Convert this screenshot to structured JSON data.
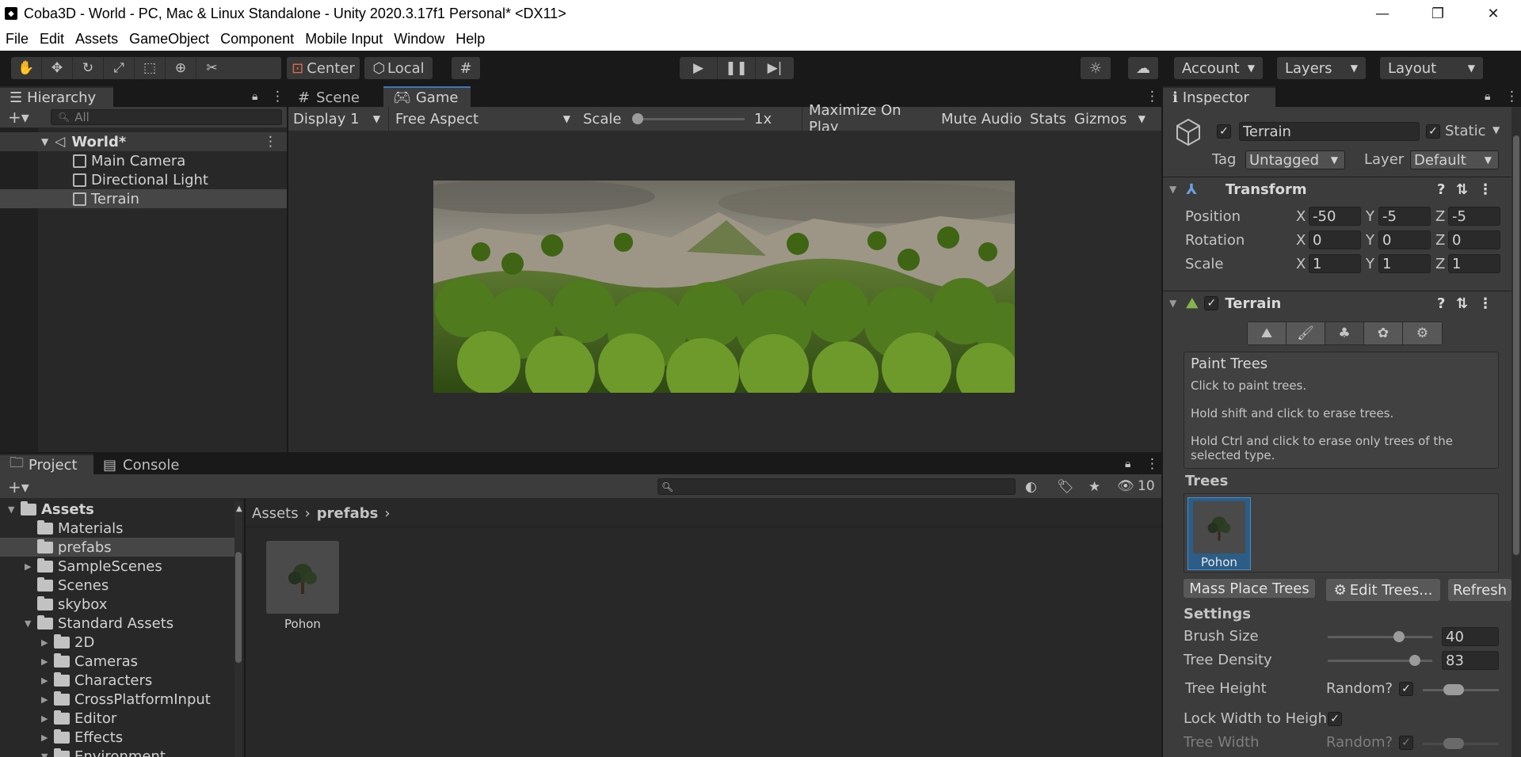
{
  "window": {
    "title": "Coba3D - World - PC, Mac & Linux Standalone - Unity 2020.3.17f1 Personal* <DX11>",
    "controls": [
      "—",
      "❐",
      "✕"
    ]
  },
  "menu": [
    "File",
    "Edit",
    "Assets",
    "GameObject",
    "Component",
    "Mobile Input",
    "Window",
    "Help"
  ],
  "toolbar": {
    "pivot_label": "Center",
    "space_label": "Local",
    "account_label": "Account",
    "layers_label": "Layers",
    "layout_label": "Layout"
  },
  "hierarchy": {
    "tab": "Hierarchy",
    "search_placeholder": "All",
    "scene": "World*",
    "items": [
      "Main Camera",
      "Directional Light",
      "Terrain"
    ],
    "selected": "Terrain"
  },
  "view": {
    "tabs": [
      "Scene",
      "Game"
    ],
    "active_tab": "Game",
    "display": "Display 1",
    "aspect": "Free Aspect",
    "scale_label": "Scale",
    "scale_value": "1x",
    "maximize": "Maximize On Play",
    "mute": "Mute Audio",
    "stats": "Stats",
    "gizmos": "Gizmos"
  },
  "project": {
    "tabs": [
      "Project",
      "Console"
    ],
    "hidden_count": "10",
    "tree": [
      {
        "label": "Assets",
        "indent": 0,
        "bold": true
      },
      {
        "label": "Materials",
        "indent": 1
      },
      {
        "label": "prefabs",
        "indent": 1,
        "selected": true
      },
      {
        "label": "SampleScenes",
        "indent": 1,
        "arrow": true
      },
      {
        "label": "Scenes",
        "indent": 1
      },
      {
        "label": "skybox",
        "indent": 1
      },
      {
        "label": "Standard Assets",
        "indent": 1,
        "open": true
      },
      {
        "label": "2D",
        "indent": 2,
        "arrow": true
      },
      {
        "label": "Cameras",
        "indent": 2,
        "arrow": true
      },
      {
        "label": "Characters",
        "indent": 2,
        "arrow": true
      },
      {
        "label": "CrossPlatformInput",
        "indent": 2,
        "arrow": true
      },
      {
        "label": "Editor",
        "indent": 2,
        "arrow": true
      },
      {
        "label": "Effects",
        "indent": 2,
        "arrow": true
      },
      {
        "label": "Environment",
        "indent": 2,
        "open": true
      }
    ],
    "breadcrumb": [
      "Assets",
      "prefabs"
    ],
    "asset": "Pohon"
  },
  "inspector": {
    "tab": "Inspector",
    "object_name": "Terrain",
    "static_label": "Static",
    "tag_label": "Tag",
    "tag_value": "Untagged",
    "layer_label": "Layer",
    "layer_value": "Default",
    "transform": {
      "title": "Transform",
      "rows": [
        {
          "label": "Position",
          "x": "-50",
          "y": "-5",
          "z": "-5"
        },
        {
          "label": "Rotation",
          "x": "0",
          "y": "0",
          "z": "0"
        },
        {
          "label": "Scale",
          "x": "1",
          "y": "1",
          "z": "1"
        }
      ]
    },
    "terrain": {
      "title": "Terrain",
      "help_title": "Paint Trees",
      "help_lines": [
        "Click to paint trees.",
        "Hold shift and click to erase trees.",
        "Hold Ctrl and click to erase only trees of the selected type."
      ],
      "trees_label": "Trees",
      "tree_name": "Pohon",
      "mass_place": "Mass Place Trees",
      "edit_trees": "Edit Trees...",
      "refresh": "Refresh",
      "settings_label": "Settings",
      "brush_size_label": "Brush Size",
      "brush_size": "40",
      "brush_size_fraction": 0.68,
      "tree_density_label": "Tree Density",
      "tree_density": "83",
      "tree_density_fraction": 0.83,
      "tree_height_label": "Tree Height",
      "random_label": "Random?",
      "lock_width_label": "Lock Width to Heigh",
      "tree_width_label": "Tree Width",
      "random2_label": "Random?"
    }
  },
  "axis_labels": {
    "x": "X",
    "y": "Y",
    "z": "Z"
  },
  "colors": {
    "accent": "#3a79bb",
    "selected": "#2c5d87",
    "panel": "#282828"
  }
}
